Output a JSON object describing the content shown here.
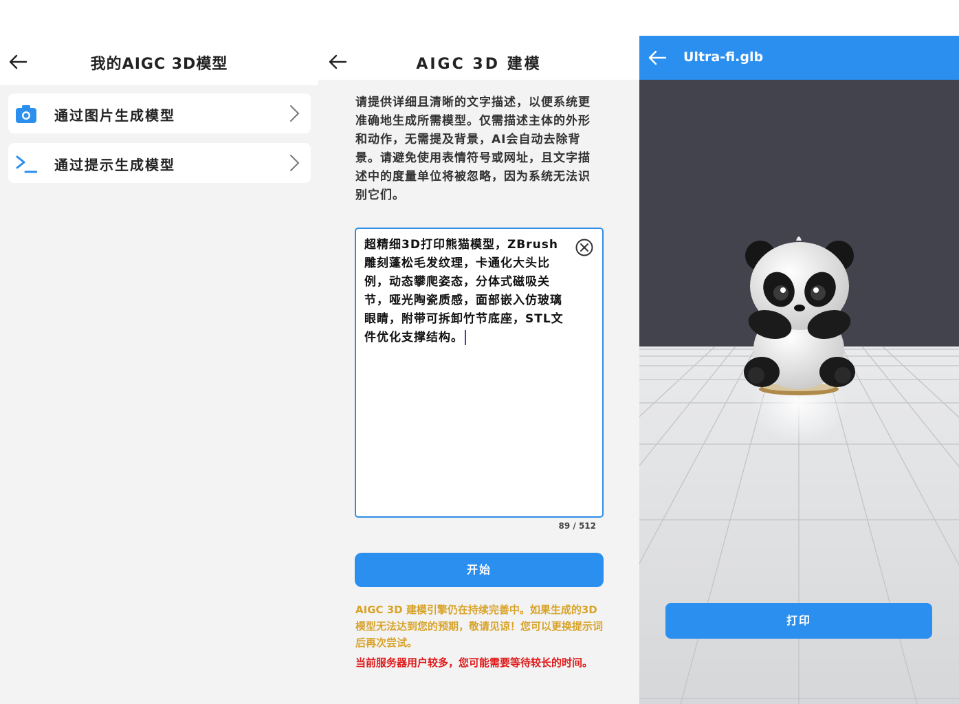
{
  "screen1": {
    "title": "我的AIGC 3D模型",
    "items": [
      {
        "label": "通过图片生成模型",
        "icon": "camera-icon"
      },
      {
        "label": "通过提示生成模型",
        "icon": "terminal-prompt-icon"
      }
    ]
  },
  "screen2": {
    "title": "AIGC 3D 建模",
    "instructions": "请提供详细且清晰的文字描述，以便系统更准确地生成所需模型。仅需描述主体的外形和动作，无需提及背景，AI会自动去除背景。请避免使用表情符号或网址，且文字描述中的度量单位将被忽略，因为系统无法识别它们。",
    "prompt_value": "超精细3D打印熊猫模型，ZBrush雕刻蓬松毛发纹理，卡通化大头比例，动态攀爬姿态，分体式磁吸关节，哑光陶瓷质感，面部嵌入仿玻璃眼睛，附带可拆卸竹节底座，STL文件优化支撑结构。",
    "counter": "89 / 512",
    "start_label": "开始",
    "warning": "AIGC 3D 建模引擎仍在持续完善中。如果生成的3D模型无法达到您的预期，敬请见谅！您可以更换提示词后再次尝试。",
    "alert": "当前服务器用户较多，您可能需要等待较长的时间。"
  },
  "screen3": {
    "filename": "Ultra-fi.glb",
    "print_label": "打印"
  },
  "colors": {
    "accent": "#2b8ff0",
    "warning": "#d8a32a",
    "alert": "#e01b1b",
    "background": "#f3f3f3"
  }
}
